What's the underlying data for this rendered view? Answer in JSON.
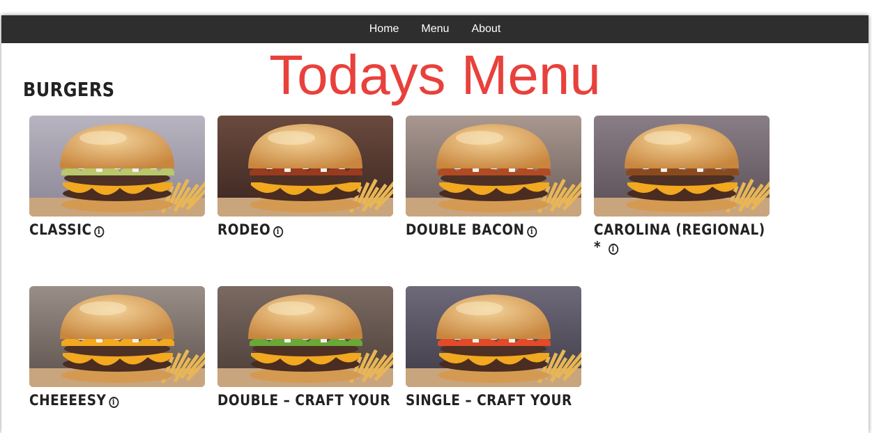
{
  "nav": {
    "items": [
      {
        "label": "Home"
      },
      {
        "label": "Menu"
      },
      {
        "label": "About"
      }
    ]
  },
  "page_title": "Todays Menu",
  "section": {
    "title": "BURGERS"
  },
  "items": [
    {
      "label": "CLASSIC",
      "image": "classic-burger",
      "accent": "#b9c86a"
    },
    {
      "label": "RODEO",
      "image": "rodeo-burger",
      "accent": "#9a3a1e"
    },
    {
      "label": "DOUBLE BACON",
      "image": "double-bacon-burger",
      "accent": "#b24a22"
    },
    {
      "label": "CAROLINA (REGIONAL) *",
      "image": "carolina-burger",
      "accent": "#8a4a1e"
    },
    {
      "label": "CHEEEESY",
      "image": "cheeeesy-burger",
      "accent": "#f2a81f"
    },
    {
      "label": "DOUBLE – CRAFT YOUR",
      "image": "double-craft-burger",
      "accent": "#6aa838"
    },
    {
      "label": "SINGLE – CRAFT YOUR",
      "image": "single-craft-burger",
      "accent": "#e24a2a"
    }
  ],
  "colors": {
    "nav_bg": "#2e2e2e",
    "title": "#e8413c",
    "text": "#222222",
    "cheese": "#f2a81f",
    "bun": "#d9a25a"
  }
}
